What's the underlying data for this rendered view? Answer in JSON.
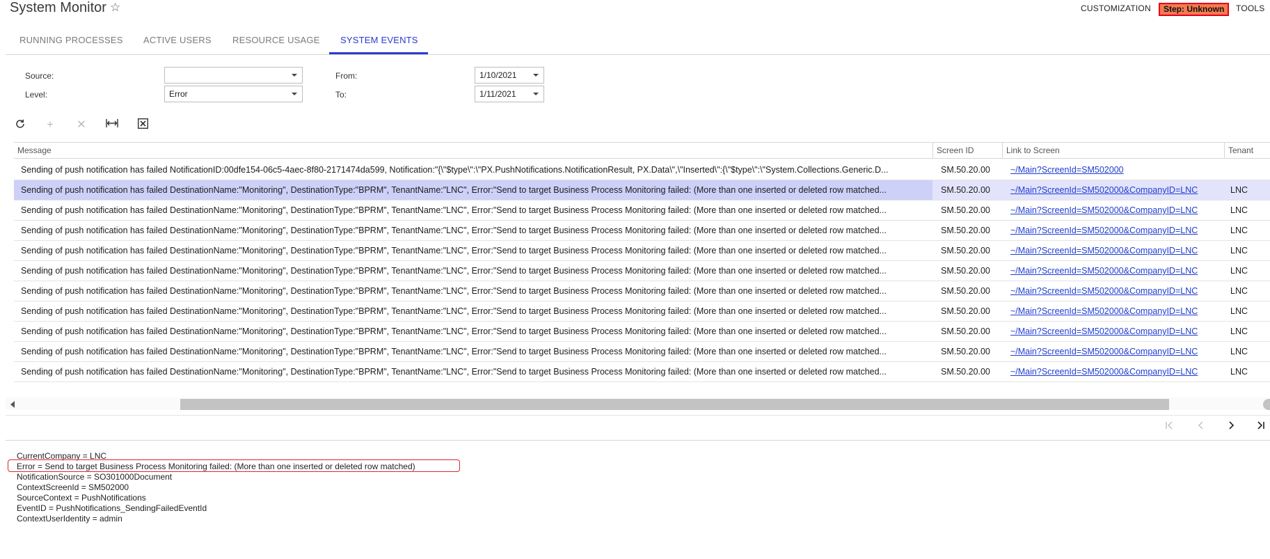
{
  "header": {
    "title": "System Monitor",
    "customization_label": "CUSTOMIZATION",
    "step_label": "Step: Unknown",
    "tools_label": "TOOLS"
  },
  "tabs": [
    {
      "label": "RUNNING PROCESSES",
      "active": false
    },
    {
      "label": "ACTIVE USERS",
      "active": false
    },
    {
      "label": "RESOURCE USAGE",
      "active": false
    },
    {
      "label": "SYSTEM EVENTS",
      "active": true
    }
  ],
  "filters": {
    "source_label": "Source:",
    "source_value": "",
    "level_label": "Level:",
    "level_value": "Error",
    "from_label": "From:",
    "from_value": "1/10/2021",
    "to_label": "To:",
    "to_value": "1/11/2021"
  },
  "toolbar": {
    "refresh_icon": "refresh-icon",
    "add_icon": "plus-icon",
    "delete_icon": "close-icon",
    "fit_icon": "fit-columns-icon",
    "export_icon": "excel-export-icon"
  },
  "grid": {
    "columns": [
      "Message",
      "Screen ID",
      "Link to Screen",
      "Tenant"
    ],
    "rows": [
      {
        "message": "Sending of push notification has failed NotificationID:00dfe154-06c5-4aec-8f80-2171474da599, Notification:\"{\\\"$type\\\":\\\"PX.PushNotifications.NotificationResult, PX.Data\\\",\\\"Inserted\\\":{\\\"$type\\\":\\\"System.Collections.Generic.D...",
        "screen_id": "SM.50.20.00",
        "link": "~/Main?ScreenId=SM502000",
        "tenant": ""
      },
      {
        "message": "Sending of push notification has failed DestinationName:\"Monitoring\", DestinationType:\"BPRM\", TenantName:\"LNC\", Error:\"Send to target Business Process Monitoring failed: (More than one inserted or deleted row matched...",
        "screen_id": "SM.50.20.00",
        "link": "~/Main?ScreenId=SM502000&CompanyID=LNC",
        "tenant": "LNC"
      },
      {
        "message": "Sending of push notification has failed DestinationName:\"Monitoring\", DestinationType:\"BPRM\", TenantName:\"LNC\", Error:\"Send to target Business Process Monitoring failed: (More than one inserted or deleted row matched...",
        "screen_id": "SM.50.20.00",
        "link": "~/Main?ScreenId=SM502000&CompanyID=LNC",
        "tenant": "LNC"
      },
      {
        "message": "Sending of push notification has failed DestinationName:\"Monitoring\", DestinationType:\"BPRM\", TenantName:\"LNC\", Error:\"Send to target Business Process Monitoring failed: (More than one inserted or deleted row matched...",
        "screen_id": "SM.50.20.00",
        "link": "~/Main?ScreenId=SM502000&CompanyID=LNC",
        "tenant": "LNC"
      },
      {
        "message": "Sending of push notification has failed DestinationName:\"Monitoring\", DestinationType:\"BPRM\", TenantName:\"LNC\", Error:\"Send to target Business Process Monitoring failed: (More than one inserted or deleted row matched...",
        "screen_id": "SM.50.20.00",
        "link": "~/Main?ScreenId=SM502000&CompanyID=LNC",
        "tenant": "LNC"
      },
      {
        "message": "Sending of push notification has failed DestinationName:\"Monitoring\", DestinationType:\"BPRM\", TenantName:\"LNC\", Error:\"Send to target Business Process Monitoring failed: (More than one inserted or deleted row matched...",
        "screen_id": "SM.50.20.00",
        "link": "~/Main?ScreenId=SM502000&CompanyID=LNC",
        "tenant": "LNC"
      },
      {
        "message": "Sending of push notification has failed DestinationName:\"Monitoring\", DestinationType:\"BPRM\", TenantName:\"LNC\", Error:\"Send to target Business Process Monitoring failed: (More than one inserted or deleted row matched...",
        "screen_id": "SM.50.20.00",
        "link": "~/Main?ScreenId=SM502000&CompanyID=LNC",
        "tenant": "LNC"
      },
      {
        "message": "Sending of push notification has failed DestinationName:\"Monitoring\", DestinationType:\"BPRM\", TenantName:\"LNC\", Error:\"Send to target Business Process Monitoring failed: (More than one inserted or deleted row matched...",
        "screen_id": "SM.50.20.00",
        "link": "~/Main?ScreenId=SM502000&CompanyID=LNC",
        "tenant": "LNC"
      },
      {
        "message": "Sending of push notification has failed DestinationName:\"Monitoring\", DestinationType:\"BPRM\", TenantName:\"LNC\", Error:\"Send to target Business Process Monitoring failed: (More than one inserted or deleted row matched...",
        "screen_id": "SM.50.20.00",
        "link": "~/Main?ScreenId=SM502000&CompanyID=LNC",
        "tenant": "LNC"
      },
      {
        "message": "Sending of push notification has failed DestinationName:\"Monitoring\", DestinationType:\"BPRM\", TenantName:\"LNC\", Error:\"Send to target Business Process Monitoring failed: (More than one inserted or deleted row matched...",
        "screen_id": "SM.50.20.00",
        "link": "~/Main?ScreenId=SM502000&CompanyID=LNC",
        "tenant": "LNC"
      },
      {
        "message": "Sending of push notification has failed DestinationName:\"Monitoring\", DestinationType:\"BPRM\", TenantName:\"LNC\", Error:\"Send to target Business Process Monitoring failed: (More than one inserted or deleted row matched...",
        "screen_id": "SM.50.20.00",
        "link": "~/Main?ScreenId=SM502000&CompanyID=LNC",
        "tenant": "LNC"
      }
    ],
    "selected_row": 1
  },
  "pager": {
    "first_icon": "first-page-icon",
    "prev_icon": "previous-page-icon",
    "next_icon": "next-page-icon",
    "last_icon": "last-page-icon"
  },
  "details": {
    "lines": [
      "CurrentCompany = LNC",
      "Error = Send to target Business Process Monitoring failed: (More than one inserted or deleted row matched)",
      "NotificationSource = SO301000Document",
      "ContextScreenId = SM502000",
      "SourceContext = PushNotifications",
      "EventID = PushNotifications_SendingFailedEventId",
      "ContextUserIdentity = admin"
    ]
  },
  "colors": {
    "accent": "#2a3bd0",
    "link": "#1f3dd1",
    "step_badge_bg": "#f47a50",
    "step_badge_border": "#e3001b",
    "selected_row": "#e3e4fb",
    "highlight_border": "#d9262c"
  }
}
